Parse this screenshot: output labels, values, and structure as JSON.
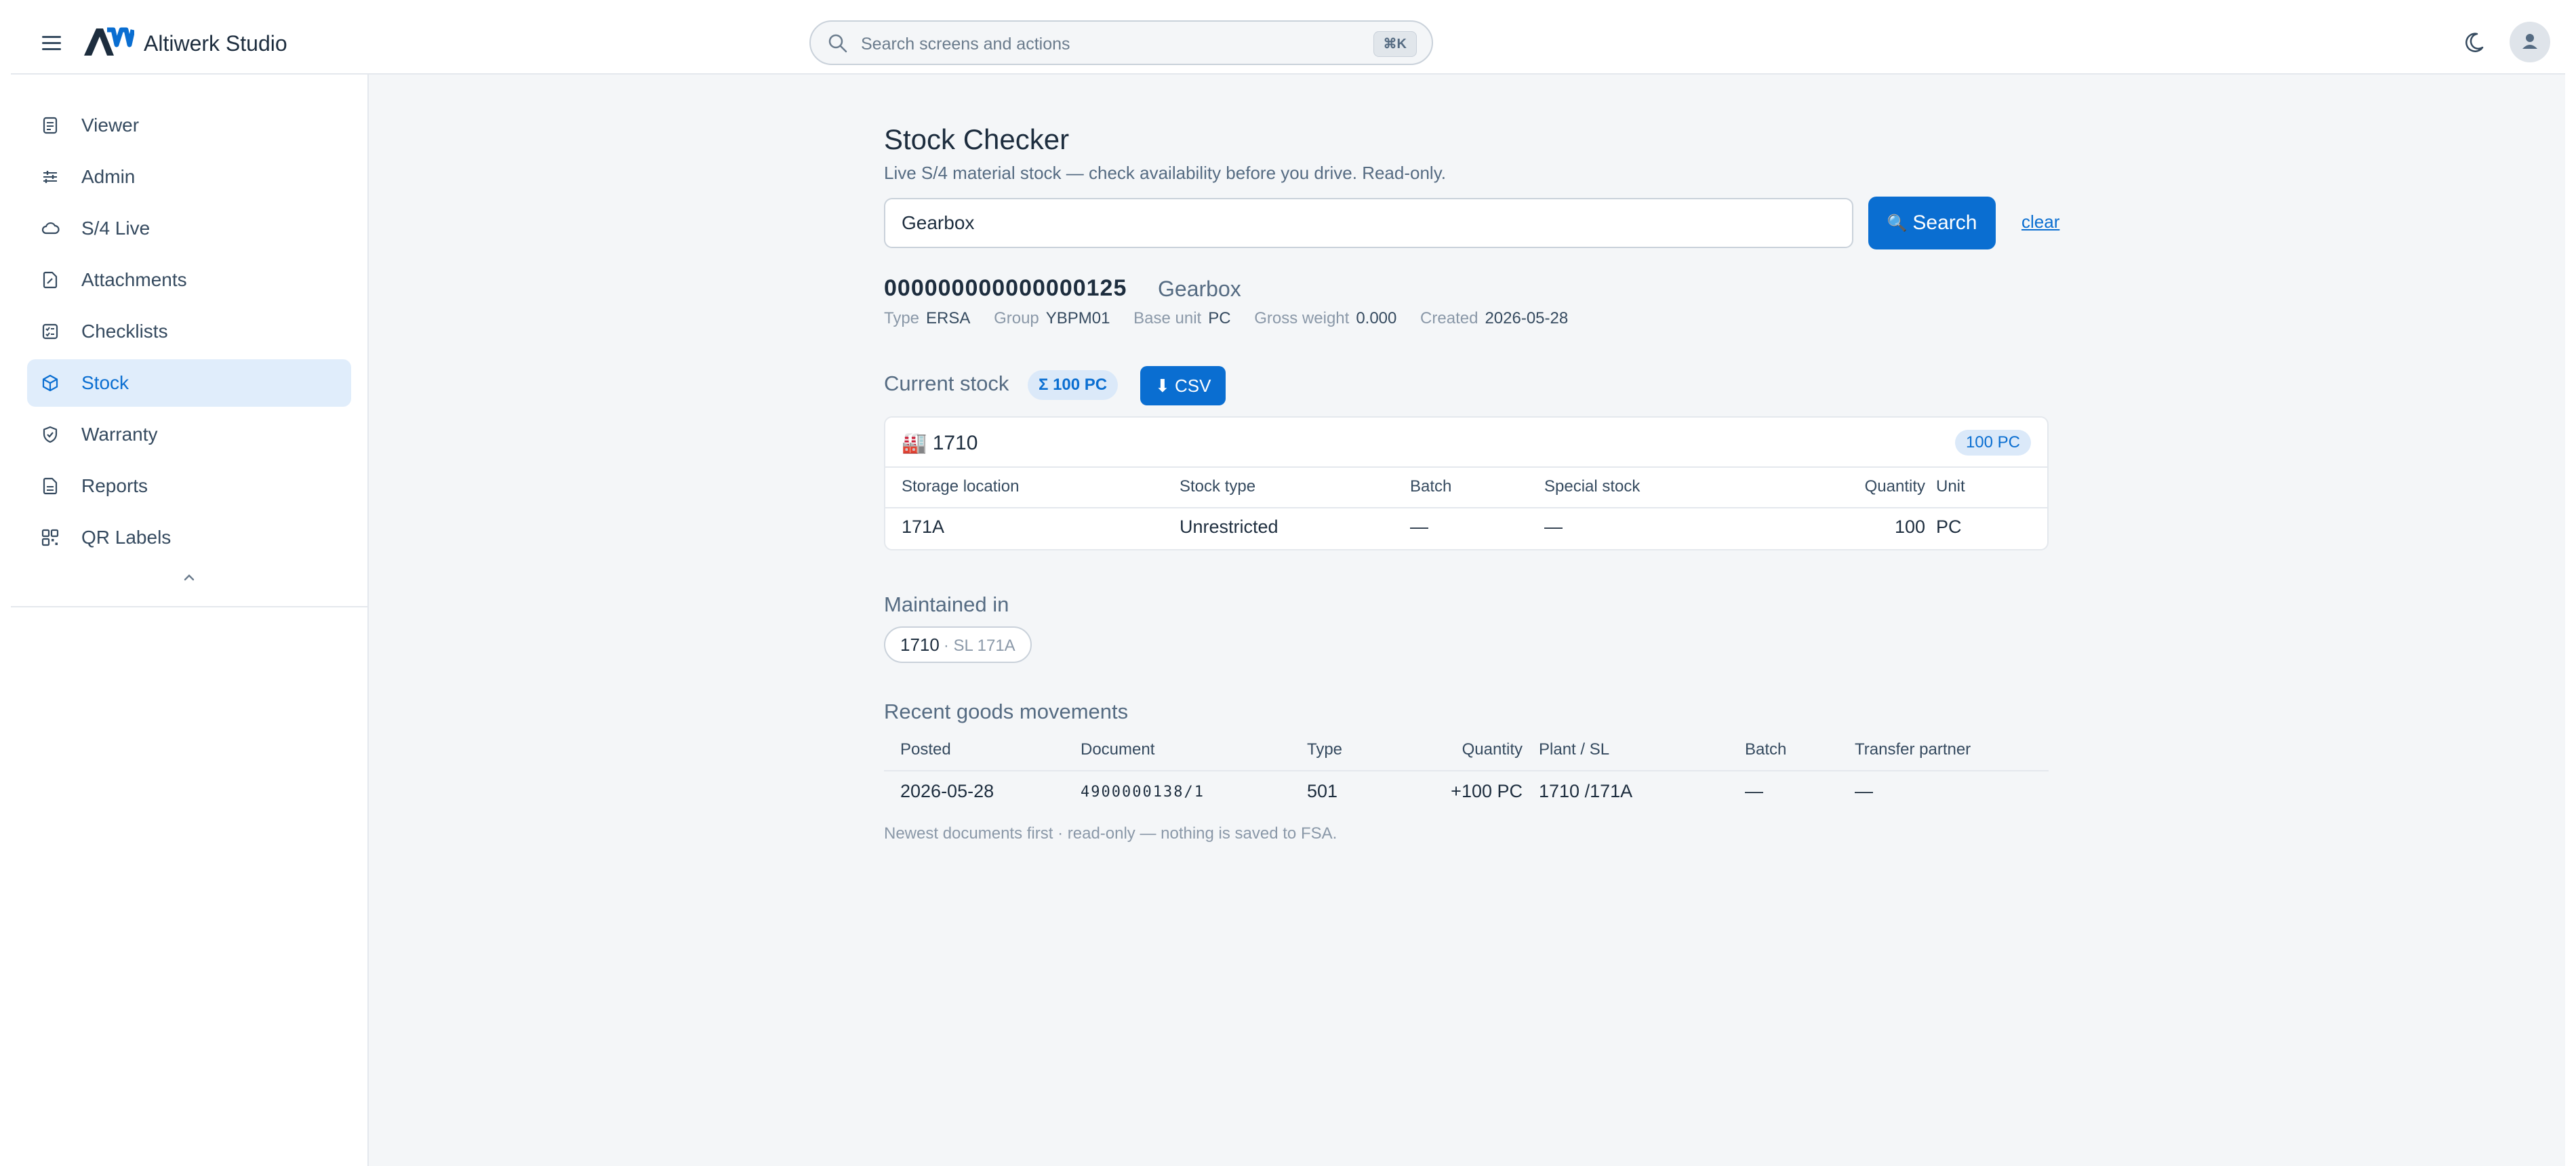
{
  "header": {
    "app_title": "Altiwerk Studio",
    "search_placeholder": "Search screens and actions",
    "search_shortcut": "⌘K",
    "icons": [
      "menu-icon",
      "logo",
      "search-icon",
      "moon-icon",
      "avatar-icon"
    ]
  },
  "sidebar": {
    "items": [
      {
        "label": "Viewer",
        "icon": "document-icon",
        "active": false
      },
      {
        "label": "Admin",
        "icon": "sliders-icon",
        "active": false
      },
      {
        "label": "S/4 Live",
        "icon": "cloud-icon",
        "active": false
      },
      {
        "label": "Attachments",
        "icon": "attachment-icon",
        "active": false
      },
      {
        "label": "Checklists",
        "icon": "checklist-icon",
        "active": false
      },
      {
        "label": "Stock",
        "icon": "box-icon",
        "active": true
      },
      {
        "label": "Warranty",
        "icon": "shield-icon",
        "active": false
      },
      {
        "label": "Reports",
        "icon": "report-icon",
        "active": false
      },
      {
        "label": "QR Labels",
        "icon": "qr-icon",
        "active": false
      }
    ]
  },
  "page": {
    "title": "Stock Checker",
    "subtitle": "Live S/4 material stock — check availability before you drive. Read-only.",
    "query": "Gearbox",
    "search_button": "Search",
    "search_button_glyph": "🔍",
    "clear_link": "clear"
  },
  "material": {
    "number": "000000000000000125",
    "description": "Gearbox",
    "meta": [
      {
        "label": "Type",
        "value": "ERSA"
      },
      {
        "label": "Group",
        "value": "YBPM01"
      },
      {
        "label": "Base unit",
        "value": "PC"
      },
      {
        "label": "Gross weight",
        "value": "0.000"
      },
      {
        "label": "Created",
        "value": "2026-05-28"
      }
    ]
  },
  "current_stock": {
    "title": "Current stock",
    "total_badge": "Σ 100 PC",
    "csv_button": "⬇ CSV",
    "plant": "🏭 1710",
    "plant_total": "100 PC",
    "columns": [
      "Storage location",
      "Stock type",
      "Batch",
      "Special stock",
      "Quantity",
      "Unit"
    ],
    "rows": [
      [
        "171A",
        "Unrestricted",
        "—",
        "—",
        "100",
        "PC"
      ]
    ]
  },
  "maintained_in": {
    "title": "Maintained in",
    "chip_plant": "1710",
    "chip_detail": "· SL 171A"
  },
  "movements": {
    "title": "Recent goods movements",
    "columns": [
      "Posted",
      "Document",
      "Type",
      "Quantity",
      "Plant / SL",
      "Batch",
      "Transfer partner"
    ],
    "rows": [
      [
        "2026-05-28",
        "4900000138/1",
        "501",
        "+100 PC",
        "1710 /171A",
        "—",
        "—"
      ]
    ],
    "footnote": "Newest documents first · read-only — nothing is saved to FSA."
  },
  "colors": {
    "accent": "#0a6ed1",
    "active_bg": "#e0edfb",
    "text": "#1d2d3e",
    "muted": "#556b82"
  }
}
